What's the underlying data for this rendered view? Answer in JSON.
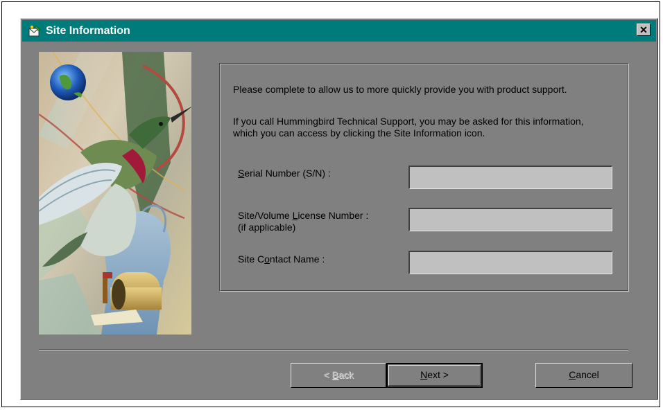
{
  "window": {
    "title": "Site Information",
    "close_label": "✕",
    "icon": "site-info-icon"
  },
  "description": {
    "line1": "Please complete to allow us to more quickly provide you with product support.",
    "line2": "If you call Hummingbird Technical Support, you may be asked for this information, which you can access by clicking the Site Information icon."
  },
  "fields": {
    "serial": {
      "label_pre": "",
      "label_accel": "S",
      "label_post": "erial Number (S/N) :",
      "value": ""
    },
    "license": {
      "label_pre": "Site/Volume ",
      "label_accel": "L",
      "label_post": "icense Number :",
      "label_line2": "(if applicable)",
      "value": ""
    },
    "contact": {
      "label_pre": "Site C",
      "label_accel": "o",
      "label_post": "ntact Name :",
      "value": ""
    }
  },
  "buttons": {
    "back": {
      "pre": "< ",
      "accel": "B",
      "post": "ack",
      "disabled": true
    },
    "next": {
      "pre": "",
      "accel": "N",
      "post": "ext >"
    },
    "cancel": {
      "pre": "",
      "accel": "C",
      "post": "ancel"
    }
  },
  "colors": {
    "titlebar": "#007b7b",
    "dialog_face": "#808080",
    "field": "#c0c0c0"
  }
}
